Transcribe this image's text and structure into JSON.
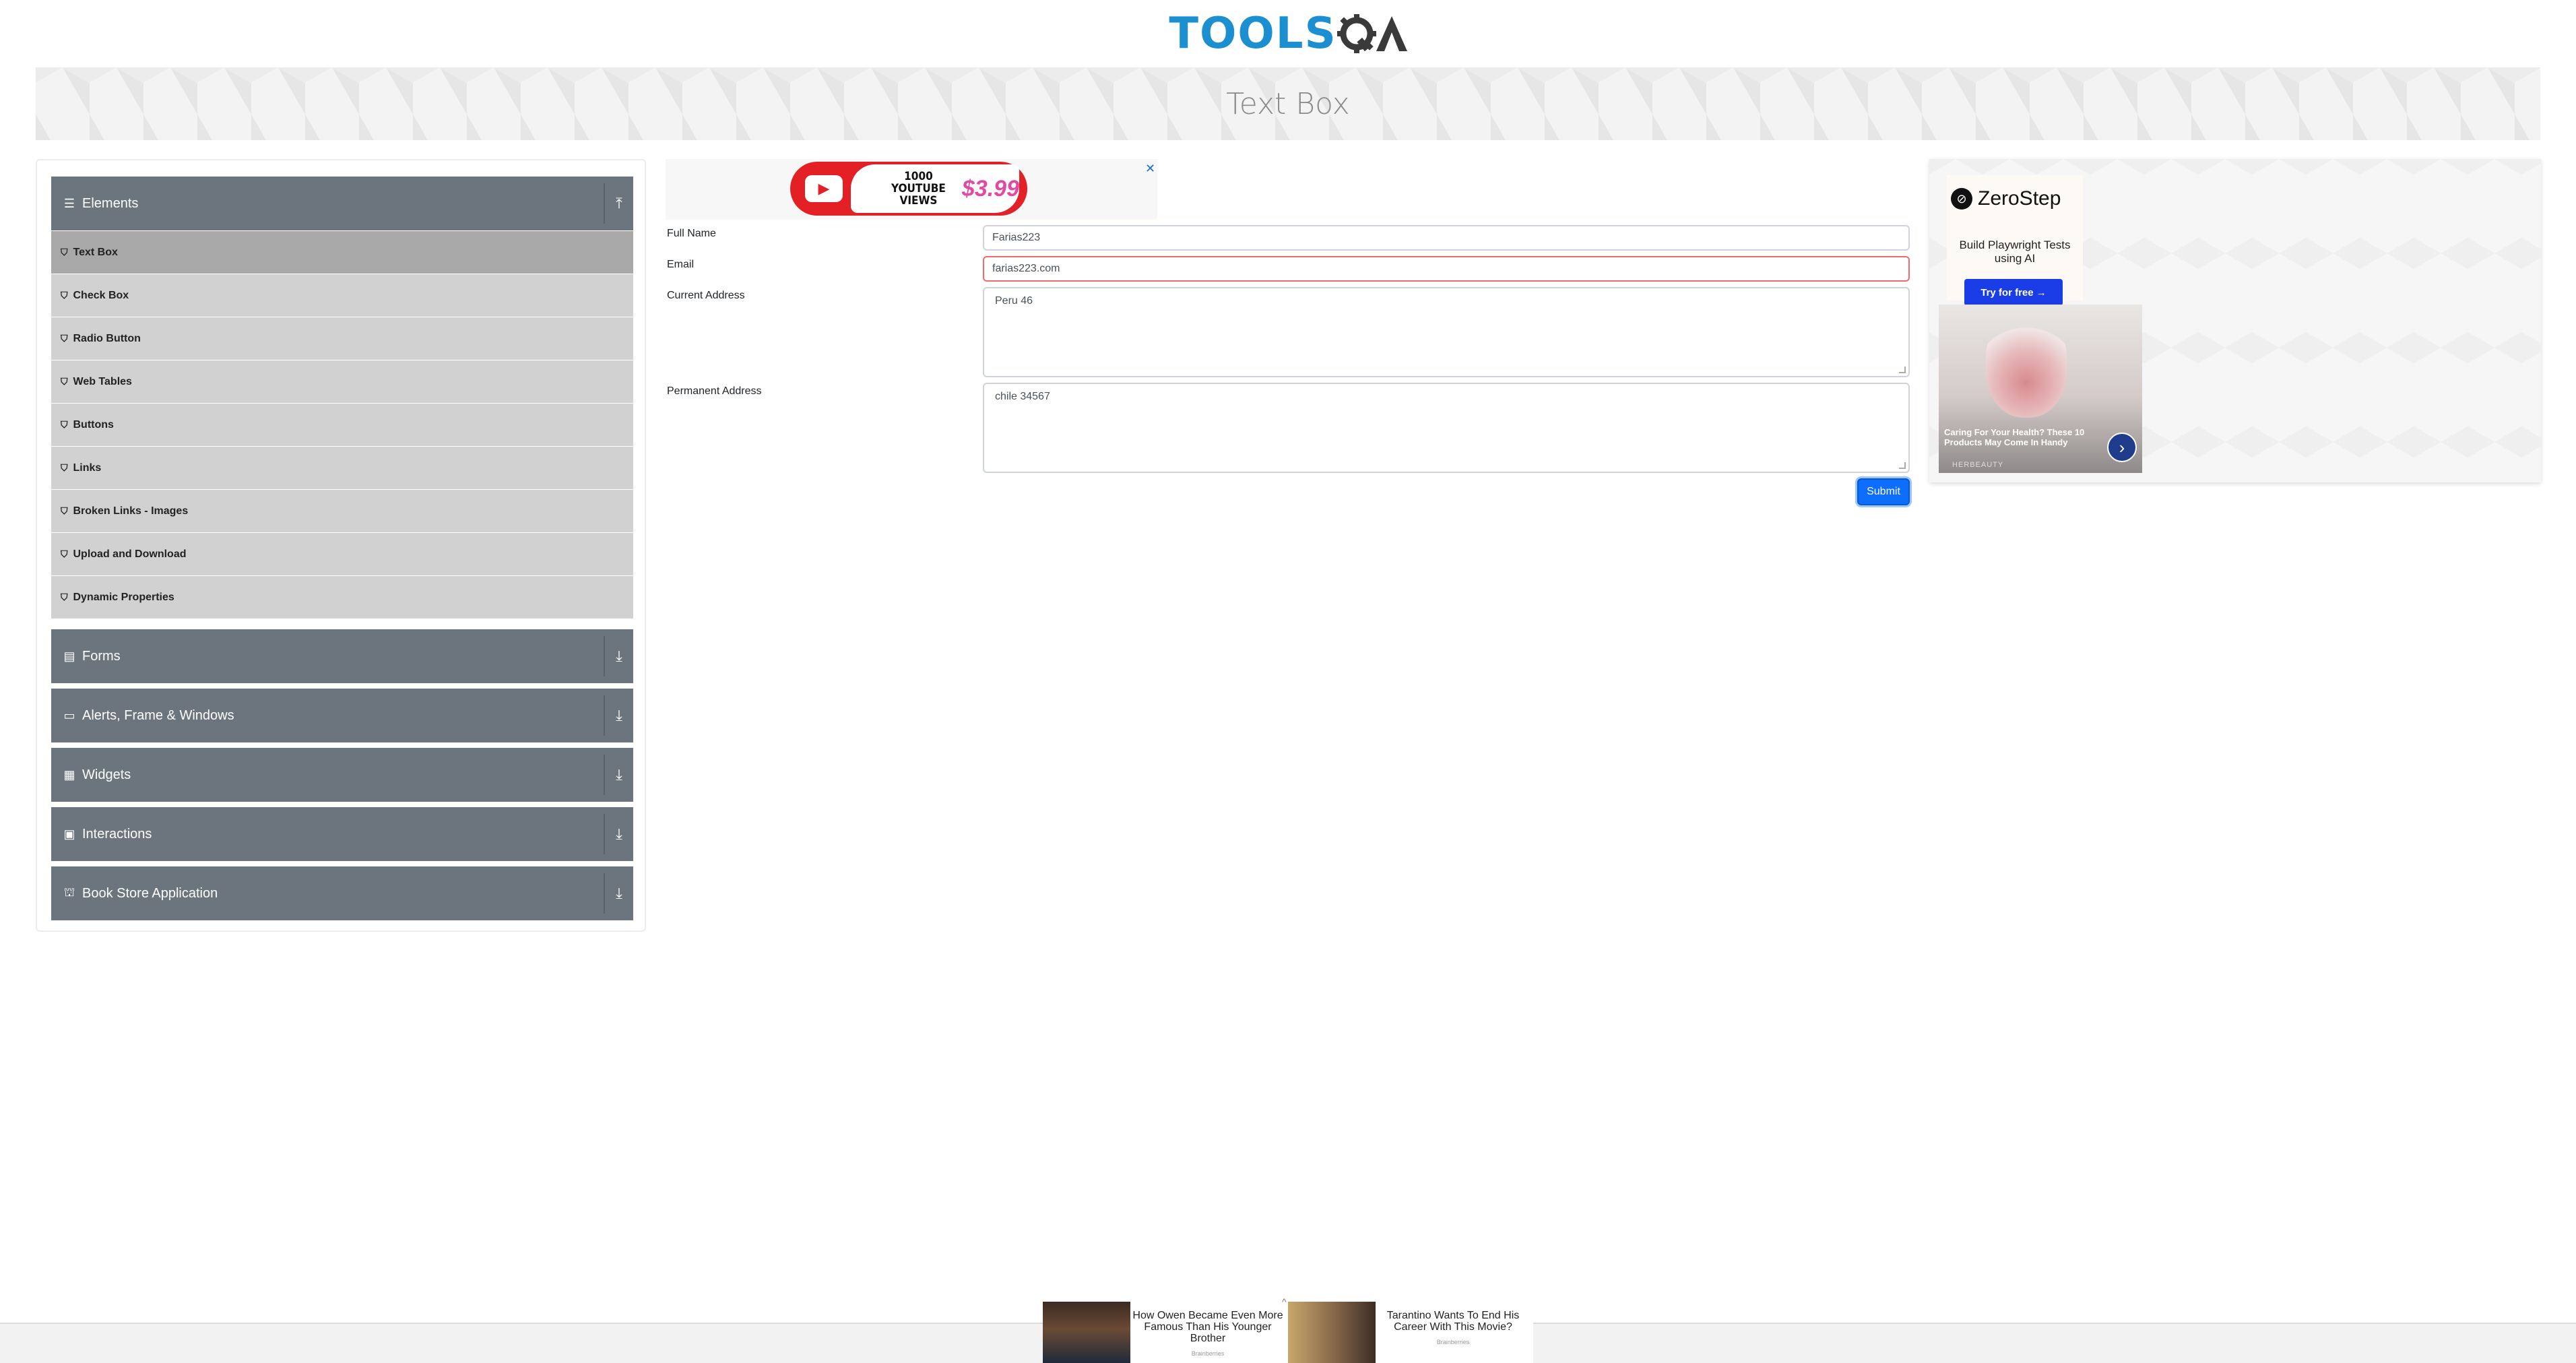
{
  "logo": {
    "tools": "TOOLS",
    "qa": "QA"
  },
  "page_title": "Text Box",
  "sidebar": {
    "groups": [
      {
        "label": "Elements",
        "icon": "hamburger-icon",
        "expanded": true
      },
      {
        "label": "Forms",
        "icon": "form-icon",
        "expanded": false
      },
      {
        "label": "Alerts, Frame & Windows",
        "icon": "window-icon",
        "expanded": false
      },
      {
        "label": "Widgets",
        "icon": "grid-icon",
        "expanded": false
      },
      {
        "label": "Interactions",
        "icon": "interaction-icon",
        "expanded": false
      },
      {
        "label": "Book Store Application",
        "icon": "book-icon",
        "expanded": false
      }
    ],
    "items": [
      {
        "label": "Text Box",
        "active": true
      },
      {
        "label": "Check Box"
      },
      {
        "label": "Radio Button"
      },
      {
        "label": "Web Tables"
      },
      {
        "label": "Buttons"
      },
      {
        "label": "Links"
      },
      {
        "label": "Broken Links - Images"
      },
      {
        "label": "Upload and Download"
      },
      {
        "label": "Dynamic Properties"
      }
    ]
  },
  "top_ad": {
    "line1": "1000",
    "line2": "YOUTUBE VIEWS",
    "price": "$3.99",
    "close": "✕"
  },
  "form": {
    "full_name": {
      "label": "Full Name",
      "value": "Farias223"
    },
    "email": {
      "label": "Email",
      "value": "farias223.com"
    },
    "current_address": {
      "label": "Current Address",
      "value": "Peru 46"
    },
    "permanent_address": {
      "label": "Permanent Address",
      "value": "chile 34567"
    },
    "submit_label": "Submit"
  },
  "right_ad": {
    "zerostep": {
      "brand": "ZeroStep",
      "tagline": "Build Playwright Tests using AI",
      "cta": "Try for free →"
    },
    "herbeauty": {
      "caption": "Caring For Your Health? These 10 Products May Come In Handy",
      "source": "HERBEAUTY"
    }
  },
  "footer_ad": {
    "close": "^",
    "items": [
      {
        "text": "How Owen Became Even More Famous Than His Younger Brother",
        "source": "Brainberries"
      },
      {
        "text": "Tarantino Wants To End His Career With This Movie?",
        "source": "Brainberries"
      }
    ]
  },
  "colors": {
    "sidebar_header": "#6c757d",
    "menu_item": "#d1d1d1",
    "active_item": "#a8a8a8",
    "primary": "#0d6efd",
    "logo_blue": "#1b8fd0",
    "error_border": "#f26b6b"
  }
}
